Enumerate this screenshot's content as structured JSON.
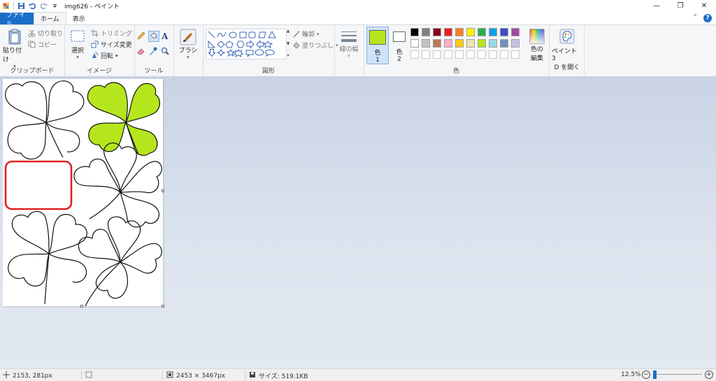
{
  "window": {
    "title": "img626 - ペイント",
    "buttons": {
      "minimize": "—",
      "restore": "❐",
      "close": "✕"
    }
  },
  "tabs": [
    {
      "label": "ファイル"
    },
    {
      "label": "ホーム"
    },
    {
      "label": "表示"
    }
  ],
  "help": "?",
  "ribbon": {
    "clipboard": {
      "paste": "貼り付け",
      "cut": "切り取り",
      "copy": "コピー",
      "group": "クリップボード"
    },
    "image": {
      "select": "選択",
      "crop": "トリミング",
      "resize": "サイズ変更",
      "rotate": "回転",
      "group": "イメージ"
    },
    "tools": {
      "group": "ツール"
    },
    "brushes": {
      "label": "ブラシ"
    },
    "shapes": {
      "outline": "輪郭",
      "fill": "塗りつぶし",
      "group": "図形"
    },
    "size": {
      "label": "線の幅"
    },
    "colors": {
      "color1": "色",
      "color1_num": "1",
      "color2": "色",
      "color2_num": "2",
      "edit_line1": "色の",
      "edit_line2": "編集",
      "group": "色",
      "color1_value": "#b5e61d",
      "color2_value": "#ffffff",
      "palette_row1": [
        "#000000",
        "#7f7f7f",
        "#880015",
        "#ed1c24",
        "#ff7f27",
        "#fff200",
        "#22b14c",
        "#00a2e8",
        "#3f48cc",
        "#a349a4"
      ],
      "palette_row2": [
        "#ffffff",
        "#c3c3c3",
        "#b97a57",
        "#ffaec9",
        "#ffc90e",
        "#efe4b0",
        "#b5e61d",
        "#99d9ea",
        "#7092be",
        "#c8bfe7"
      ]
    },
    "paint3d": {
      "line1": "ペイント 3",
      "line2": "D を開く"
    }
  },
  "status": {
    "cursor": "2153, 281px",
    "dimensions": "2453 × 3467px",
    "size": "サイズ: 519.1KB",
    "zoom": "12.5%",
    "zoom_value": 12.5
  }
}
